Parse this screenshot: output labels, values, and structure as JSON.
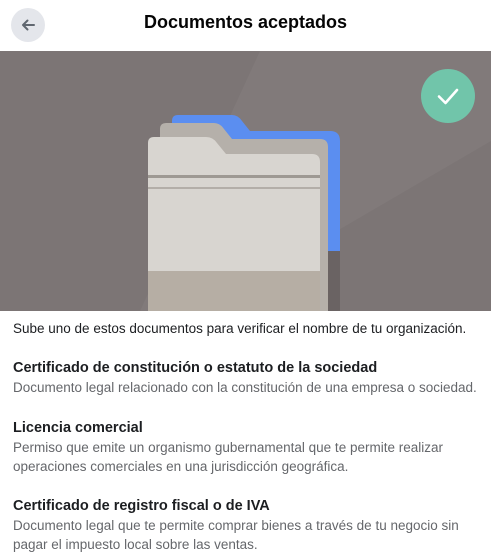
{
  "header": {
    "title": "Documentos aceptados",
    "back_icon": "arrow-left-icon"
  },
  "hero": {
    "illustration": "folder-illustration",
    "badge_icon": "checkmark-icon",
    "colors": {
      "background": "#7c7575",
      "folder_accent": "#5b8ef0",
      "badge": "#71c5aa"
    }
  },
  "intro": "Sube uno de estos documentos para verificar el nombre de tu organización.",
  "documents": [
    {
      "title": "Certificado de constitución o estatuto de la sociedad",
      "description": "Documento legal relacionado con la constitución de una empresa o sociedad."
    },
    {
      "title": "Licencia comercial",
      "description": "Permiso que emite un organismo gubernamental que te permite realizar operaciones comerciales en una jurisdicción geográfica."
    },
    {
      "title": "Certificado de registro fiscal o de IVA",
      "description": "Documento legal que te permite comprar bienes a través de tu negocio sin pagar el impuesto local sobre las ventas."
    }
  ]
}
